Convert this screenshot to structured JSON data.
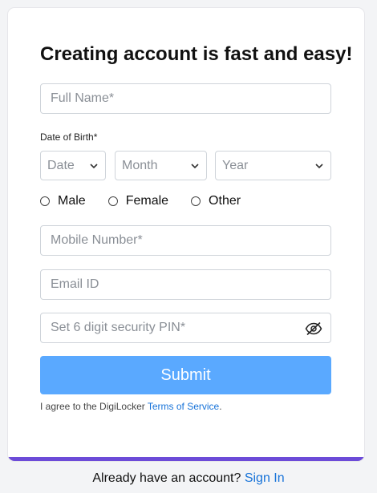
{
  "form": {
    "title": "Creating account is fast and easy!",
    "full_name_placeholder": "Full Name*",
    "dob_label": "Date of Birth*",
    "date_placeholder": "Date",
    "month_placeholder": "Month",
    "year_placeholder": "Year",
    "gender_options": [
      "Male",
      "Female",
      "Other"
    ],
    "mobile_placeholder": "Mobile Number*",
    "email_placeholder": "Email ID",
    "pin_placeholder": "Set 6 digit security PIN*",
    "submit_label": "Submit",
    "agree_prefix": "I agree to the DigiLocker ",
    "terms_link": "Terms of Service",
    "agree_suffix": "."
  },
  "footer": {
    "already_text": "Already have an account? ",
    "signin_link": "Sign In"
  },
  "colors": {
    "submit_bg": "#5aa9ff",
    "link": "#1672d8",
    "card_accent": "#6c4bd8"
  },
  "icons": {
    "pin_visibility": "eye-slash-icon",
    "select_arrow": "chevron-down-icon"
  }
}
